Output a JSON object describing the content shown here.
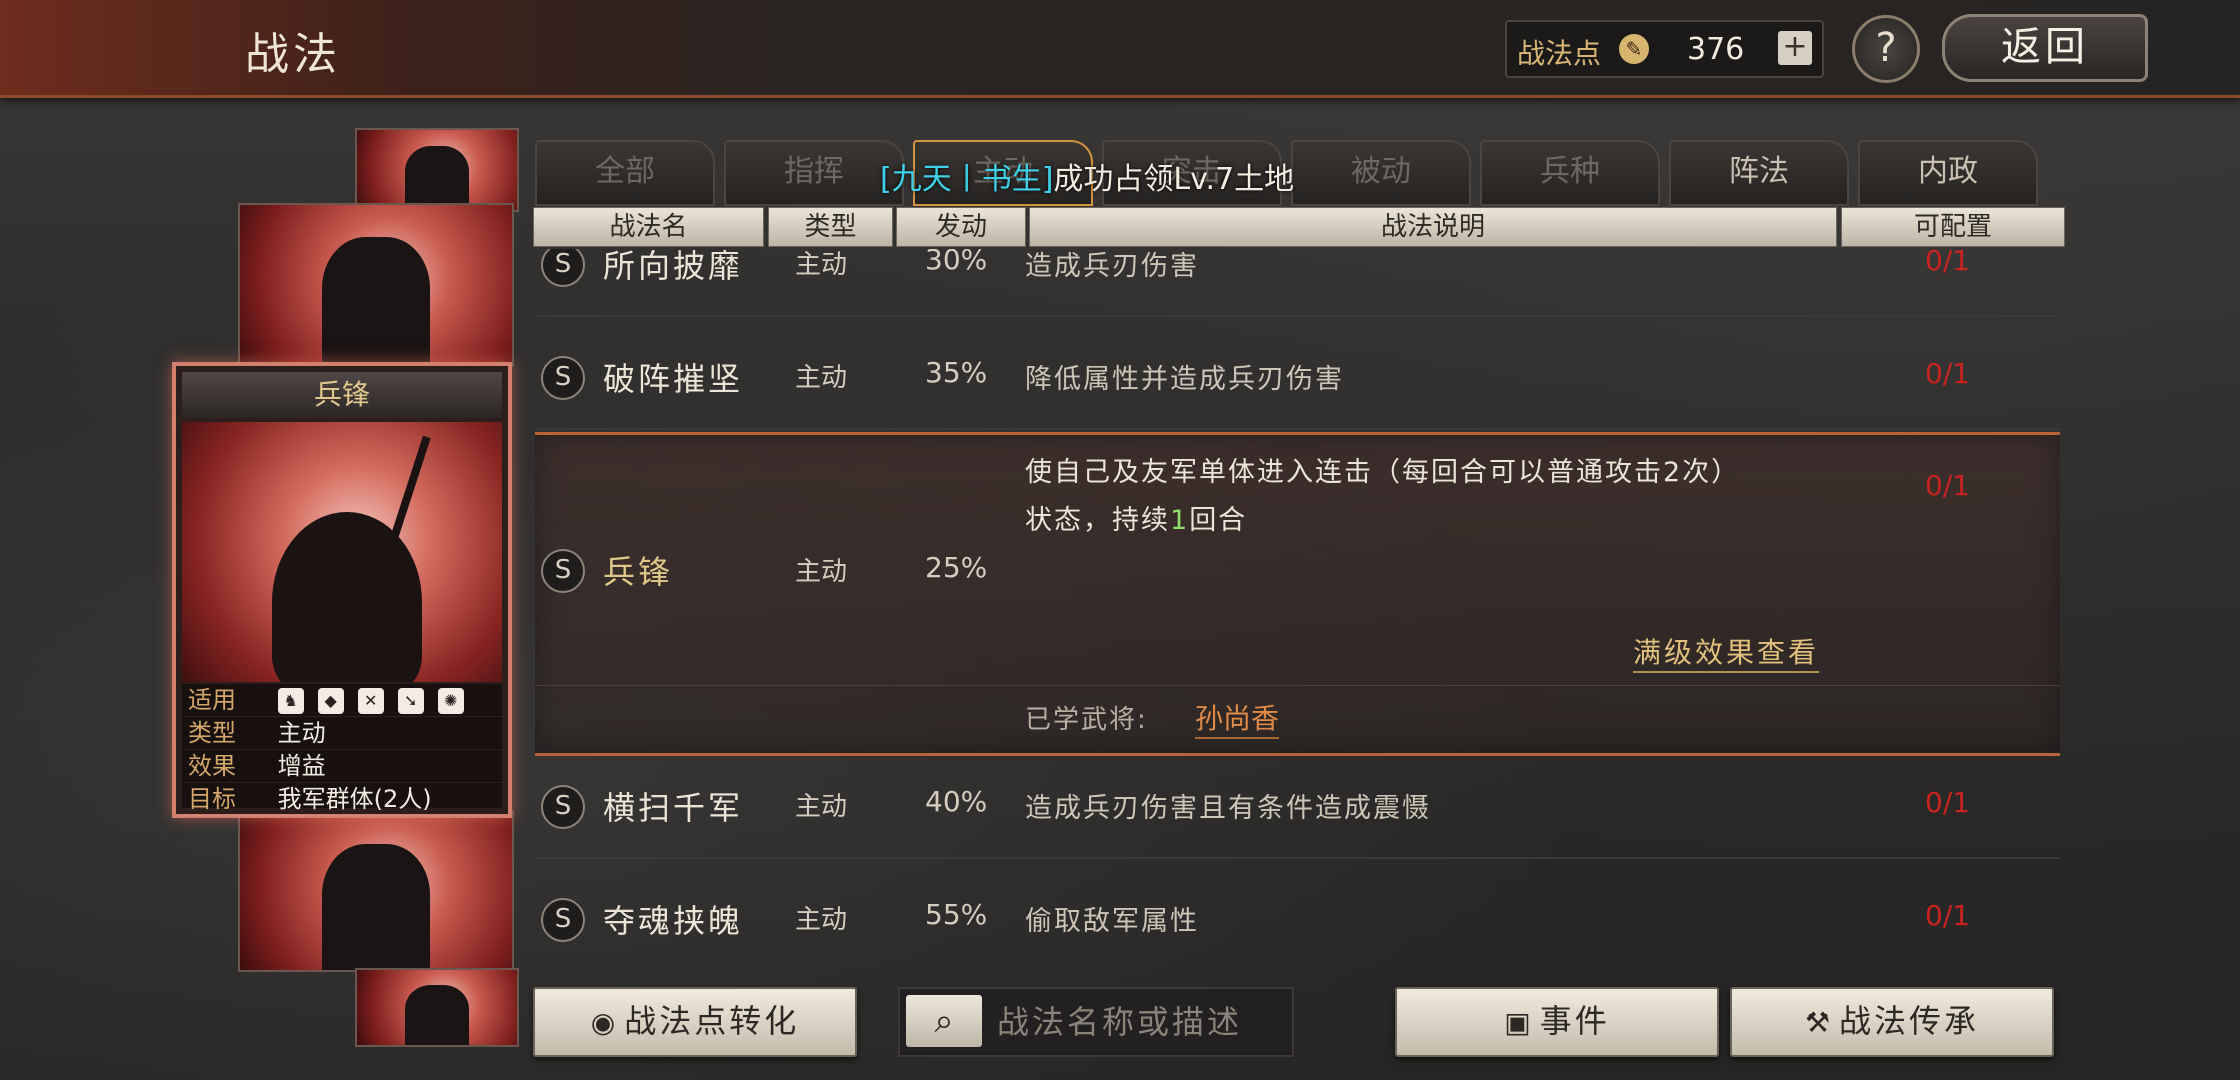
{
  "header": {
    "title": "战法",
    "points_label": "战法点",
    "points_value": "376",
    "plus": "+",
    "help": "?",
    "back": "返回"
  },
  "tabs": [
    {
      "label": "全部"
    },
    {
      "label": "指挥"
    },
    {
      "label": "主动"
    },
    {
      "label": "突击"
    },
    {
      "label": "被动"
    },
    {
      "label": "兵种"
    },
    {
      "label": "阵法"
    },
    {
      "label": "内政"
    }
  ],
  "marquee": {
    "tag": "[九天丨书生]",
    "text": "成功占领Lv.7土地"
  },
  "columns": {
    "name": "战法名",
    "type": "类型",
    "rate": "发动",
    "desc": "战法说明",
    "cfg": "可配置"
  },
  "card": {
    "title": "兵锋",
    "suit_label": "适用",
    "type_label": "类型",
    "type_value": "主动",
    "effect_label": "效果",
    "effect_value": "增益",
    "target_label": "目标",
    "target_value": "我军群体(2人)",
    "suit_icons": [
      "horse-icon",
      "shield-icon",
      "bow-icon",
      "spear-icon",
      "wheel-icon"
    ]
  },
  "rows": [
    {
      "badge": "S",
      "name": "所向披靡",
      "type": "主动",
      "rate": "30%",
      "desc": "造成兵刃伤害",
      "cfg": "0/1"
    },
    {
      "badge": "S",
      "name": "破阵摧坚",
      "type": "主动",
      "rate": "35%",
      "desc": "降低属性并造成兵刃伤害",
      "cfg": "0/1"
    },
    {
      "badge": "S",
      "name": "兵锋",
      "type": "主动",
      "rate": "25%",
      "desc_line1": "使自己及友军单体进入连击（每回合可以普通攻击2次）",
      "desc_line2_a": "状态，持续",
      "desc_line2_hl": "1",
      "desc_line2_b": "回合",
      "cfg": "0/1",
      "full_link": "满级效果查看",
      "learned_label": "已学武将:",
      "learned_name": "孙尚香"
    },
    {
      "badge": "S",
      "name": "横扫千军",
      "type": "主动",
      "rate": "40%",
      "desc": "造成兵刃伤害且有条件造成震慑",
      "cfg": "0/1"
    },
    {
      "badge": "S",
      "name": "夺魂挟魄",
      "type": "主动",
      "rate": "55%",
      "desc": "偷取敌军属性",
      "cfg": "0/1"
    }
  ],
  "bottom": {
    "convert": "战法点转化",
    "search_placeholder": "战法名称或描述",
    "events": "事件",
    "inherit": "战法传承"
  },
  "colors": {
    "accent_gold": "#d9b676",
    "cfg_red": "#c8231f",
    "tag_cyan": "#3fd1ea",
    "learned_orange": "#e28a48"
  }
}
